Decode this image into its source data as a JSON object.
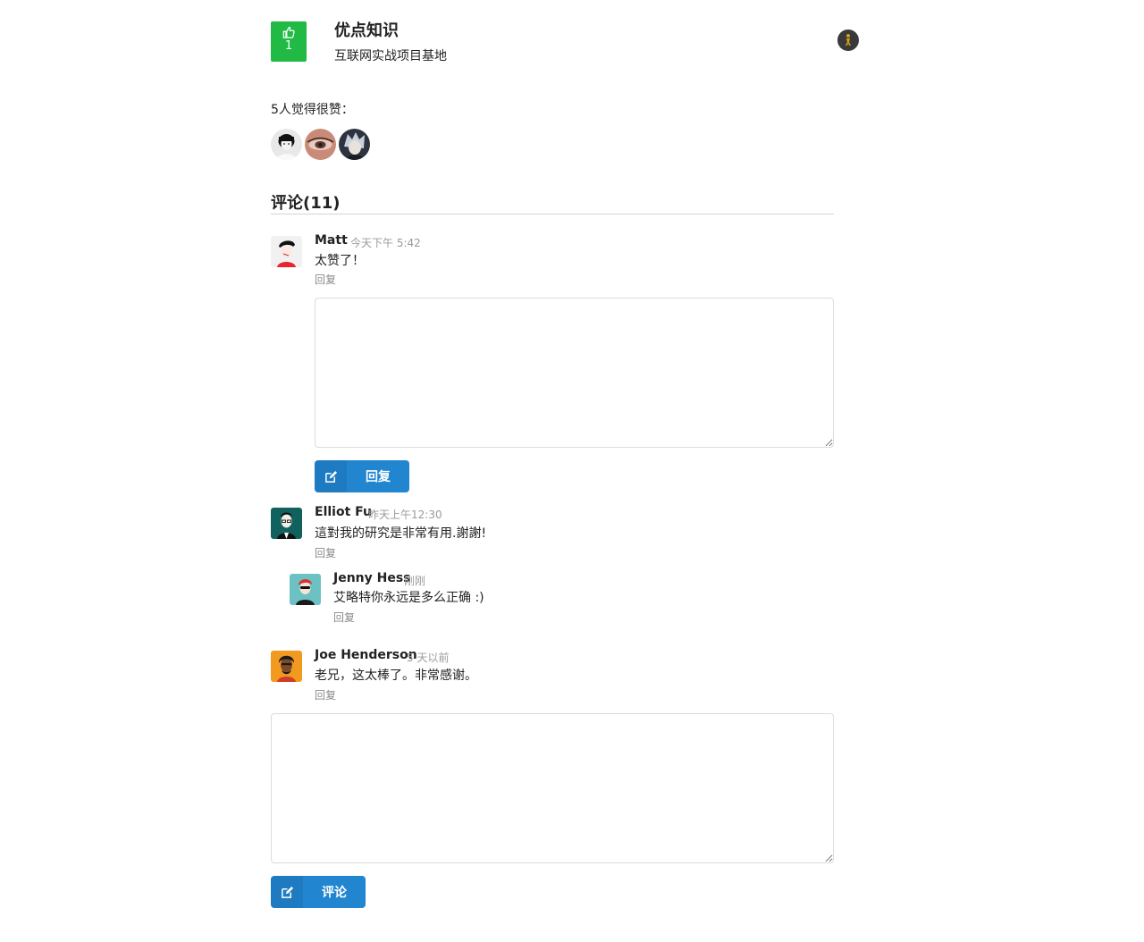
{
  "header": {
    "like_count": "1",
    "title": "优点知识",
    "subtitle": "互联网实战项目基地"
  },
  "likers": {
    "label": "5人觉得很赞："
  },
  "comments": {
    "header": "评论(11)",
    "items": [
      {
        "author": "Matt",
        "time": "今天下午 5:42",
        "text": "太赞了！",
        "reply": "回复"
      },
      {
        "author": "Elliot Fu",
        "time": "昨天上午12:30",
        "text": "這對我的研究是非常有用.謝謝!",
        "reply": "回复",
        "children": [
          {
            "author": "Jenny Hess",
            "time": "刚刚",
            "text": "艾略特你永远是多么正确 :)",
            "reply": "回复"
          }
        ]
      },
      {
        "author": "Joe Henderson",
        "time": "5 天以前",
        "text": "老兄，这太棒了。非常感谢。",
        "reply": "回复"
      }
    ]
  },
  "reply_form": {
    "button_label": "回复"
  },
  "comment_form": {
    "button_label": "评论"
  },
  "colors": {
    "like_green": "#21ba45",
    "button_blue": "#2185d0"
  },
  "icons": {
    "like": "thumbs-up-icon",
    "edit": "edit-icon"
  }
}
